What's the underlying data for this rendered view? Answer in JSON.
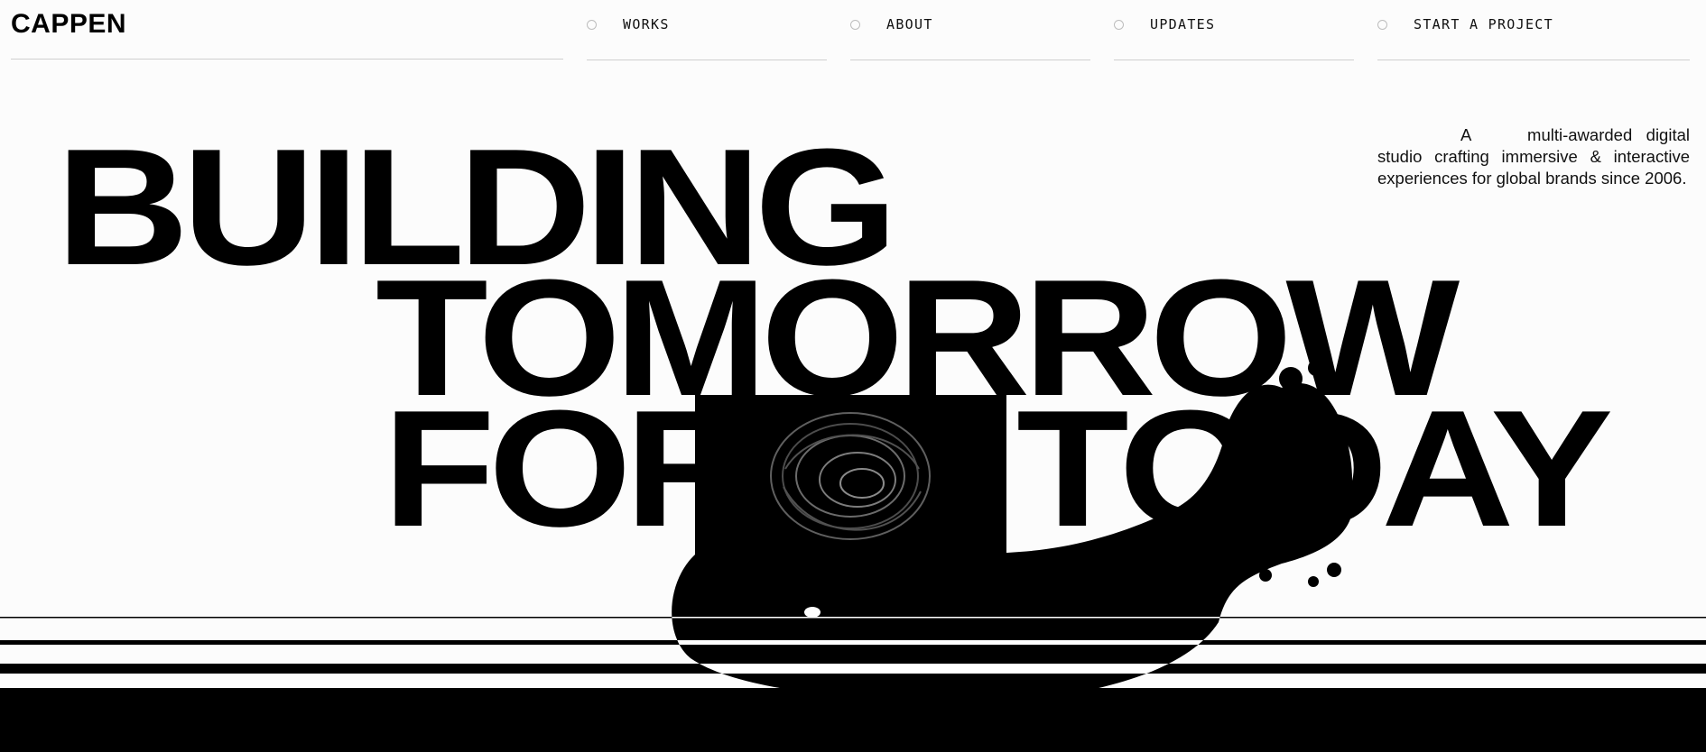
{
  "brand": {
    "logo": "CAPPEN"
  },
  "nav": {
    "works": "WORKS",
    "about": "ABOUT",
    "updates": "UPDATES",
    "start": "START A PROJECT"
  },
  "hero": {
    "tagline_lead": "A",
    "tagline_rest": "multi-awarded digital studio crafting immersive & interactive experiences for global brands since 2006.",
    "headline": {
      "line1": "BUILDING",
      "line2": "TOMORROW",
      "line3_a": "FOR",
      "line3_b": "TODAY"
    },
    "media": "abstract-spiral-sculpture-video"
  },
  "colors": {
    "background": "#fcfcfc",
    "ink": "#000000",
    "rule": "#cfcfcf"
  }
}
